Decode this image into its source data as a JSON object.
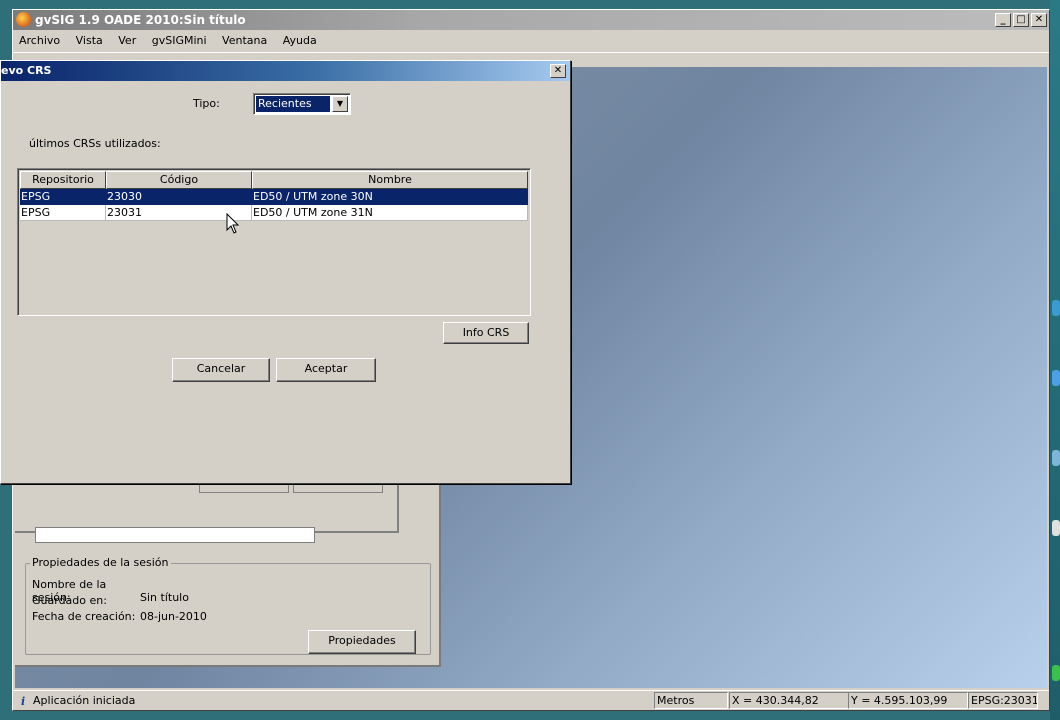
{
  "app": {
    "title": "gvSIG 1.9 OADE 2010:Sin título",
    "window_buttons": [
      "_",
      "□",
      "✕"
    ]
  },
  "menu": [
    "Archivo",
    "Vista",
    "Ver",
    "gvSIGMini",
    "Ventana",
    "Ayuda"
  ],
  "dialog": {
    "title": "evo CRS",
    "close_label": "✕",
    "tipo_label": "Tipo:",
    "tipo_value": "Recientes",
    "recent_label": "últimos CRSs utilizados:",
    "columns": [
      "Repositorio",
      "Código",
      "Nombre"
    ],
    "rows": [
      {
        "repositorio": "EPSG",
        "codigo": "23030",
        "nombre": "ED50 / UTM zone 30N",
        "selected": true
      },
      {
        "repositorio": "EPSG",
        "codigo": "23031",
        "nombre": "ED50 / UTM zone 31N",
        "selected": false
      }
    ],
    "info_button": "Info CRS",
    "cancel_button": "Cancelar",
    "accept_button": "Aceptar"
  },
  "session": {
    "legend": "Propiedades de la sesión",
    "name_label": "Nombre de la sesión:",
    "name_value": "Sin título",
    "saved_label": "Guardado en:",
    "saved_value": "",
    "date_label": "Fecha de creación:",
    "date_value": "08-jun-2010",
    "properties_button": "Propiedades"
  },
  "status": {
    "icon": "i",
    "message": "Aplicación iniciada",
    "units": "Metros",
    "x": "X = 430.344,82",
    "y": "Y = 4.595.103,99",
    "crs": "EPSG:23031"
  },
  "colors": {
    "selection": "#0a246a",
    "dialog_title_start": "#0a246a",
    "dialog_title_end": "#a6caf0",
    "window_face": "#d4d0c8"
  }
}
